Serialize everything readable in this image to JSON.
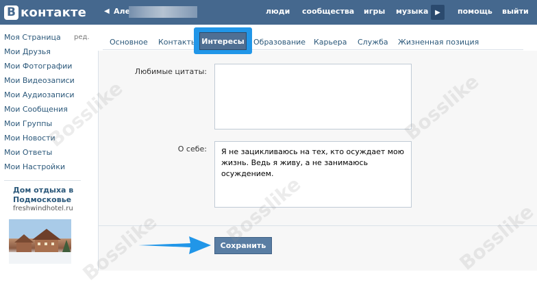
{
  "header": {
    "logo_letter": "В",
    "logo_text": "контакте",
    "back_arrow": "◀",
    "user_name": "Але",
    "nav": [
      "люди",
      "сообщества",
      "игры",
      "музыка"
    ],
    "nav_more_icon": "▶",
    "nav_right": [
      "помощь",
      "выйти"
    ]
  },
  "sidebar": {
    "items": [
      "Моя Страница",
      "Мои Друзья",
      "Мои Фотографии",
      "Мои Видеозаписи",
      "Мои Аудиозаписи",
      "Мои Сообщения",
      "Мои Группы",
      "Мои Новости",
      "Мои Ответы",
      "Мои Настройки"
    ],
    "edit_label": "ред.",
    "ad_title": "Дом отдыха в Подмосковье",
    "ad_domain": "freshwindhotel.ru"
  },
  "tabs": {
    "items": [
      "Основное",
      "Контакты",
      "Интересы",
      "Образование",
      "Карьера",
      "Служба",
      "Жизненная позиция"
    ],
    "active_index": 2
  },
  "form": {
    "quotes_label": "Любимые цитаты:",
    "quotes_value": "",
    "about_label": "О себе:",
    "about_value": "Я не зацикливаюсь на тех, кто осуждает мою жизнь. Ведь я живу, а не занимаюсь осуждением.",
    "save_label": "Сохранить"
  },
  "watermark": "Bosslike",
  "colors": {
    "header_bg": "#45688e",
    "link": "#2b587a",
    "highlight": "#2196e8",
    "button": "#597da3"
  }
}
